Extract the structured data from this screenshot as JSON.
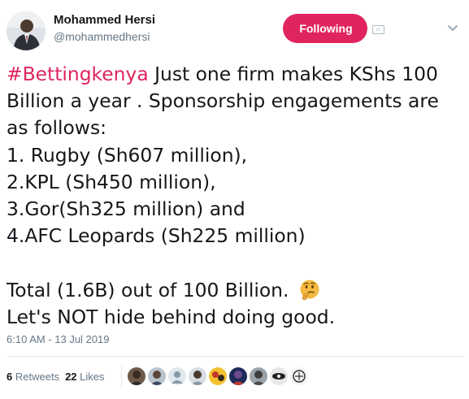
{
  "author": {
    "name": "Mohammed Hersi",
    "handle": "@mohammedhersi"
  },
  "follow_button": {
    "label": "Following",
    "color": "#e0245e"
  },
  "tweet": {
    "hashtag": "#Bettingkenya",
    "lines": [
      " Just one firm makes KShs 100",
      "Billion a year . Sponsorship engagements are",
      "as follows:",
      "1. Rugby (Sh607 million),",
      "2.KPL (Sh450 million),",
      "3.Gor(Sh325 million) and",
      "4.AFC Leopards (Sh225 million)",
      "Total (1.6B) out of 100 Billion. ",
      "Let's NOT hide behind doing good."
    ],
    "emoji": "thinking-face",
    "hashtag_color": "#e0245e"
  },
  "timestamp": "6:10 AM - 13 Jul 2019",
  "stats": {
    "retweets_count": "6",
    "retweets_label": "Retweets",
    "likes_count": "22",
    "likes_label": "Likes"
  },
  "likers": [
    {
      "icon": "user-avatar-1"
    },
    {
      "icon": "user-avatar-2"
    },
    {
      "icon": "default-user-avatar"
    },
    {
      "icon": "user-avatar-4"
    },
    {
      "icon": "user-avatar-5"
    },
    {
      "icon": "user-avatar-6"
    },
    {
      "icon": "user-avatar-7"
    },
    {
      "icon": "user-avatar-8"
    },
    {
      "icon": "user-avatar-9"
    }
  ]
}
